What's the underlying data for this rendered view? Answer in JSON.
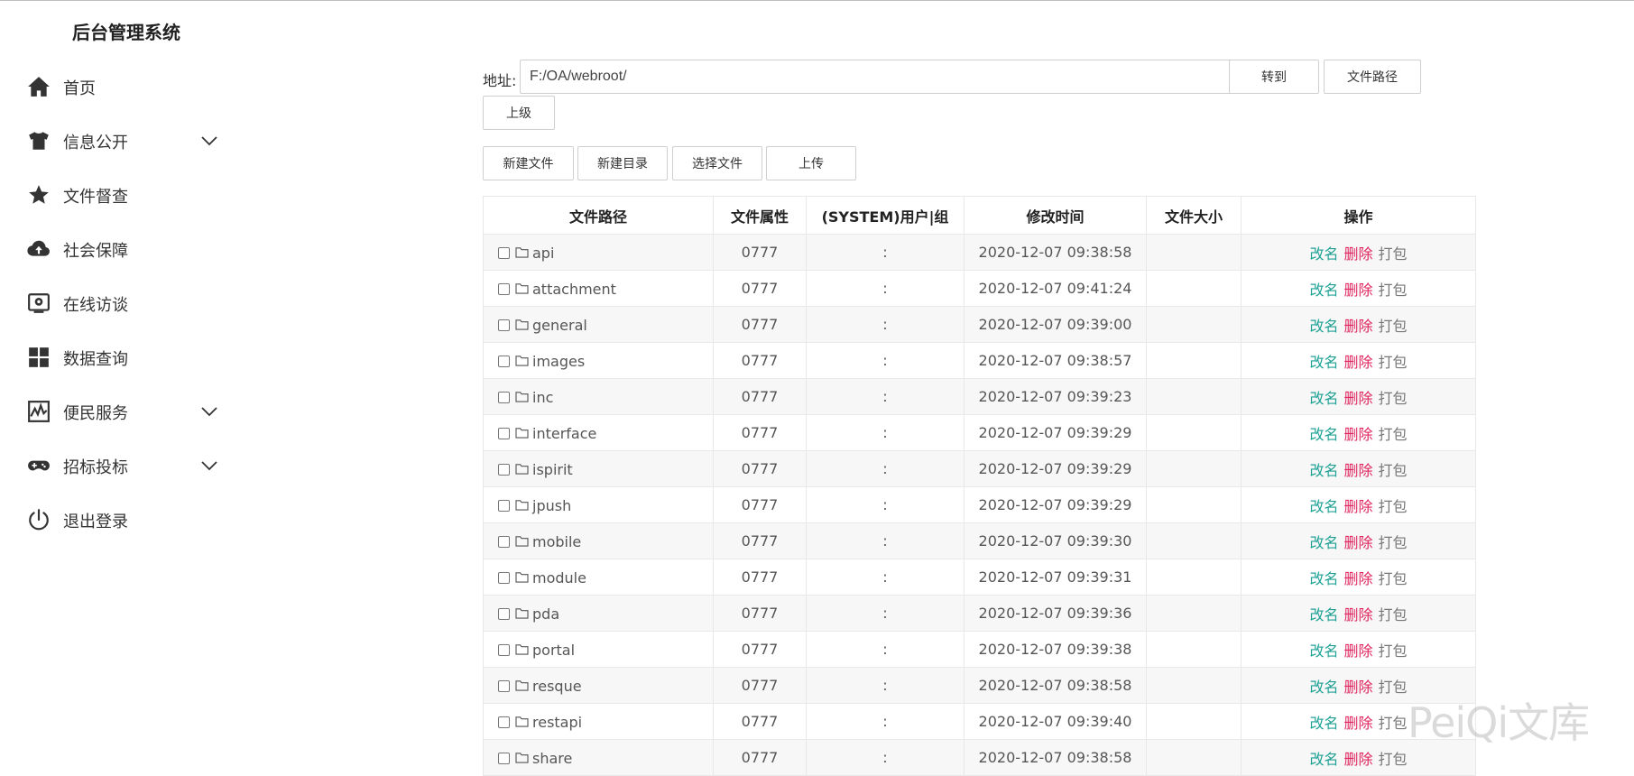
{
  "brand": "后台管理系统",
  "nav": [
    {
      "label": "首页",
      "icon": "home-icon",
      "expandable": false
    },
    {
      "label": "信息公开",
      "icon": "shirt-icon",
      "expandable": true
    },
    {
      "label": "文件督查",
      "icon": "star-icon",
      "expandable": false
    },
    {
      "label": "社会保障",
      "icon": "cloud-upload-icon",
      "expandable": false
    },
    {
      "label": "在线访谈",
      "icon": "monitor-icon",
      "expandable": false
    },
    {
      "label": "数据查询",
      "icon": "grid-icon",
      "expandable": false
    },
    {
      "label": "便民服务",
      "icon": "chart-icon",
      "expandable": true
    },
    {
      "label": "招标投标",
      "icon": "gamepad-icon",
      "expandable": true
    },
    {
      "label": "退出登录",
      "icon": "power-icon",
      "expandable": false
    }
  ],
  "address": {
    "label": "地址:",
    "value": "F:/OA/webroot/"
  },
  "buttons": {
    "goto": "转到",
    "file_path": "文件路径",
    "parent": "上级",
    "new_file": "新建文件",
    "new_dir": "新建目录",
    "choose_file": "选择文件",
    "upload": "上传"
  },
  "table": {
    "headers": [
      "文件路径",
      "文件属性",
      "(SYSTEM)用户|组",
      "修改时间",
      "文件大小",
      "操作"
    ],
    "actions": {
      "rename": "改名",
      "delete": "删除",
      "pack": "打包"
    },
    "rows": [
      {
        "name": "api",
        "perm": "0777",
        "owner": ":",
        "mtime": "2020-12-07 09:38:58",
        "size": ""
      },
      {
        "name": "attachment",
        "perm": "0777",
        "owner": ":",
        "mtime": "2020-12-07 09:41:24",
        "size": ""
      },
      {
        "name": "general",
        "perm": "0777",
        "owner": ":",
        "mtime": "2020-12-07 09:39:00",
        "size": ""
      },
      {
        "name": "images",
        "perm": "0777",
        "owner": ":",
        "mtime": "2020-12-07 09:38:57",
        "size": ""
      },
      {
        "name": "inc",
        "perm": "0777",
        "owner": ":",
        "mtime": "2020-12-07 09:39:23",
        "size": ""
      },
      {
        "name": "interface",
        "perm": "0777",
        "owner": ":",
        "mtime": "2020-12-07 09:39:29",
        "size": ""
      },
      {
        "name": "ispirit",
        "perm": "0777",
        "owner": ":",
        "mtime": "2020-12-07 09:39:29",
        "size": ""
      },
      {
        "name": "jpush",
        "perm": "0777",
        "owner": ":",
        "mtime": "2020-12-07 09:39:29",
        "size": ""
      },
      {
        "name": "mobile",
        "perm": "0777",
        "owner": ":",
        "mtime": "2020-12-07 09:39:30",
        "size": ""
      },
      {
        "name": "module",
        "perm": "0777",
        "owner": ":",
        "mtime": "2020-12-07 09:39:31",
        "size": ""
      },
      {
        "name": "pda",
        "perm": "0777",
        "owner": ":",
        "mtime": "2020-12-07 09:39:36",
        "size": ""
      },
      {
        "name": "portal",
        "perm": "0777",
        "owner": ":",
        "mtime": "2020-12-07 09:39:38",
        "size": ""
      },
      {
        "name": "resque",
        "perm": "0777",
        "owner": ":",
        "mtime": "2020-12-07 09:38:58",
        "size": ""
      },
      {
        "name": "restapi",
        "perm": "0777",
        "owner": ":",
        "mtime": "2020-12-07 09:39:40",
        "size": ""
      },
      {
        "name": "share",
        "perm": "0777",
        "owner": ":",
        "mtime": "2020-12-07 09:38:58",
        "size": ""
      }
    ]
  },
  "watermark": "PeiQi文库"
}
